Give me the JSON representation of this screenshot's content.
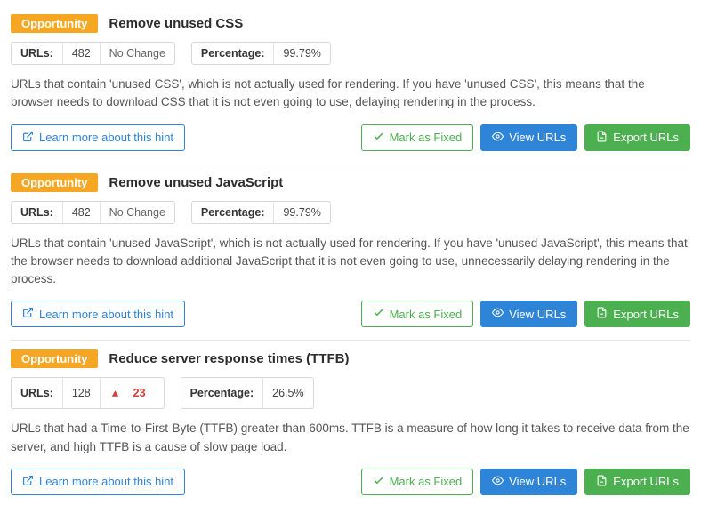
{
  "badge_text": "Opportunity",
  "labels": {
    "urls": "URLs:",
    "percentage": "Percentage:"
  },
  "buttons": {
    "learn": "Learn more about this hint",
    "mark_fixed": "Mark as Fixed",
    "view_urls": "View URLs",
    "export_urls": "Export URLs"
  },
  "hints": [
    {
      "title": "Remove unused CSS",
      "urls": "482",
      "change": "No Change",
      "change_type": "none",
      "percentage": "99.79%",
      "desc": "URLs that contain 'unused CSS', which is not actually used for rendering. If you have 'unused CSS', this means that the browser needs to download CSS that it is not even going to use, delaying rendering in the process."
    },
    {
      "title": "Remove unused JavaScript",
      "urls": "482",
      "change": "No Change",
      "change_type": "none",
      "percentage": "99.79%",
      "desc": "URLs that contain 'unused JavaScript', which is not actually used for rendering. If you have 'unused JavaScript', this means that the browser needs to download additional JavaScript that it is not even going to use, unnecessarily delaying rendering in the process."
    },
    {
      "title": "Reduce server response times (TTFB)",
      "urls": "128",
      "change": "23",
      "change_type": "up",
      "percentage": "26.5%",
      "desc": "URLs that had a Time-to-First-Byte (TTFB) greater than 600ms. TTFB is a measure of how long it takes to receive data from the server, and high TTFB is a cause of slow page load."
    }
  ]
}
